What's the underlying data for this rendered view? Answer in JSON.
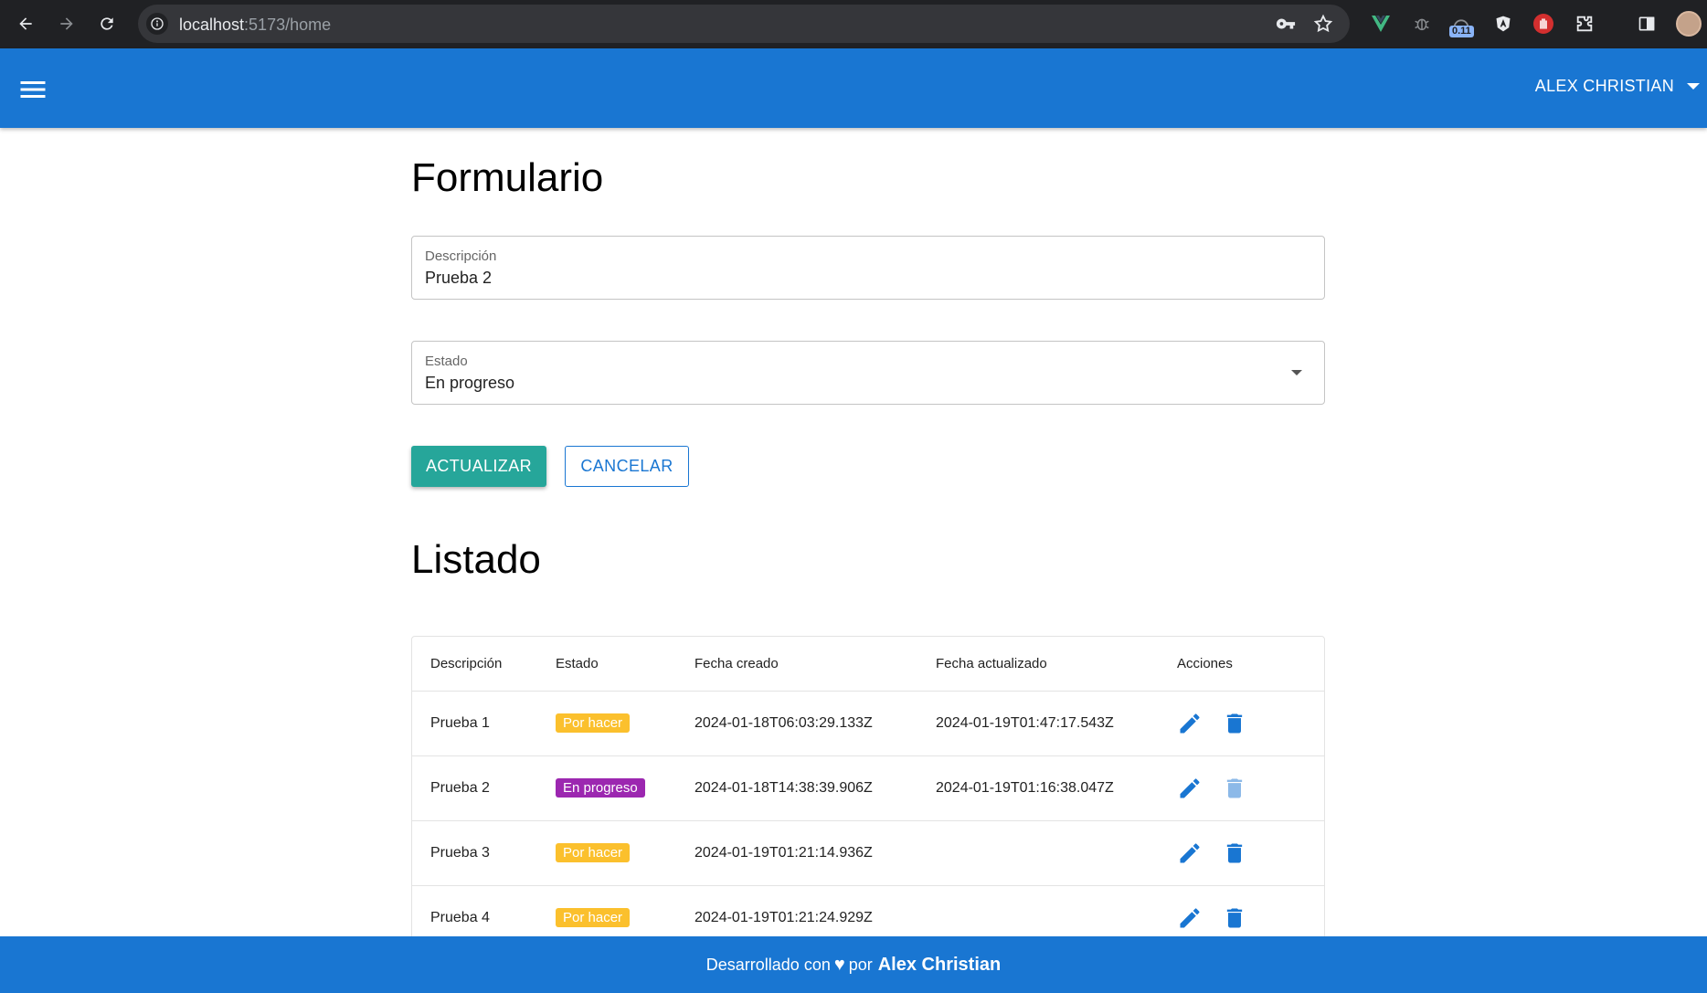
{
  "browser": {
    "url_host": "localhost",
    "url_rest": ":5173/home",
    "extension_badge": "0.11"
  },
  "app_bar": {
    "user_name": "ALEX CHRISTIAN"
  },
  "form": {
    "title": "Formulario",
    "description": {
      "label": "Descripción",
      "value": "Prueba 2"
    },
    "status": {
      "label": "Estado",
      "value": "En progreso"
    },
    "update_label": "ACTUALIZAR",
    "cancel_label": "CANCELAR"
  },
  "list": {
    "title": "Listado",
    "columns": [
      "Descripción",
      "Estado",
      "Fecha creado",
      "Fecha actualizado",
      "Acciones"
    ],
    "rows": [
      {
        "description": "Prueba 1",
        "status": "Por hacer",
        "status_color": "#fbc02d",
        "created": "2024-01-18T06:03:29.133Z",
        "updated": "2024-01-19T01:47:17.543Z",
        "delete_enabled": true
      },
      {
        "description": "Prueba 2",
        "status": "En progreso",
        "status_color": "#9c27b0",
        "created": "2024-01-18T14:38:39.906Z",
        "updated": "2024-01-19T01:16:38.047Z",
        "delete_enabled": false
      },
      {
        "description": "Prueba 3",
        "status": "Por hacer",
        "status_color": "#fbc02d",
        "created": "2024-01-19T01:21:14.936Z",
        "updated": "",
        "delete_enabled": true
      },
      {
        "description": "Prueba 4",
        "status": "Por hacer",
        "status_color": "#fbc02d",
        "created": "2024-01-19T01:21:24.929Z",
        "updated": "",
        "delete_enabled": true
      }
    ]
  },
  "footer": {
    "prefix": "Desarrollado con",
    "heart": "♥",
    "middle": "por",
    "author": "Alex Christian"
  },
  "colors": {
    "primary": "#1976d2",
    "accent": "#26a69a",
    "browser_bg": "#202124"
  }
}
